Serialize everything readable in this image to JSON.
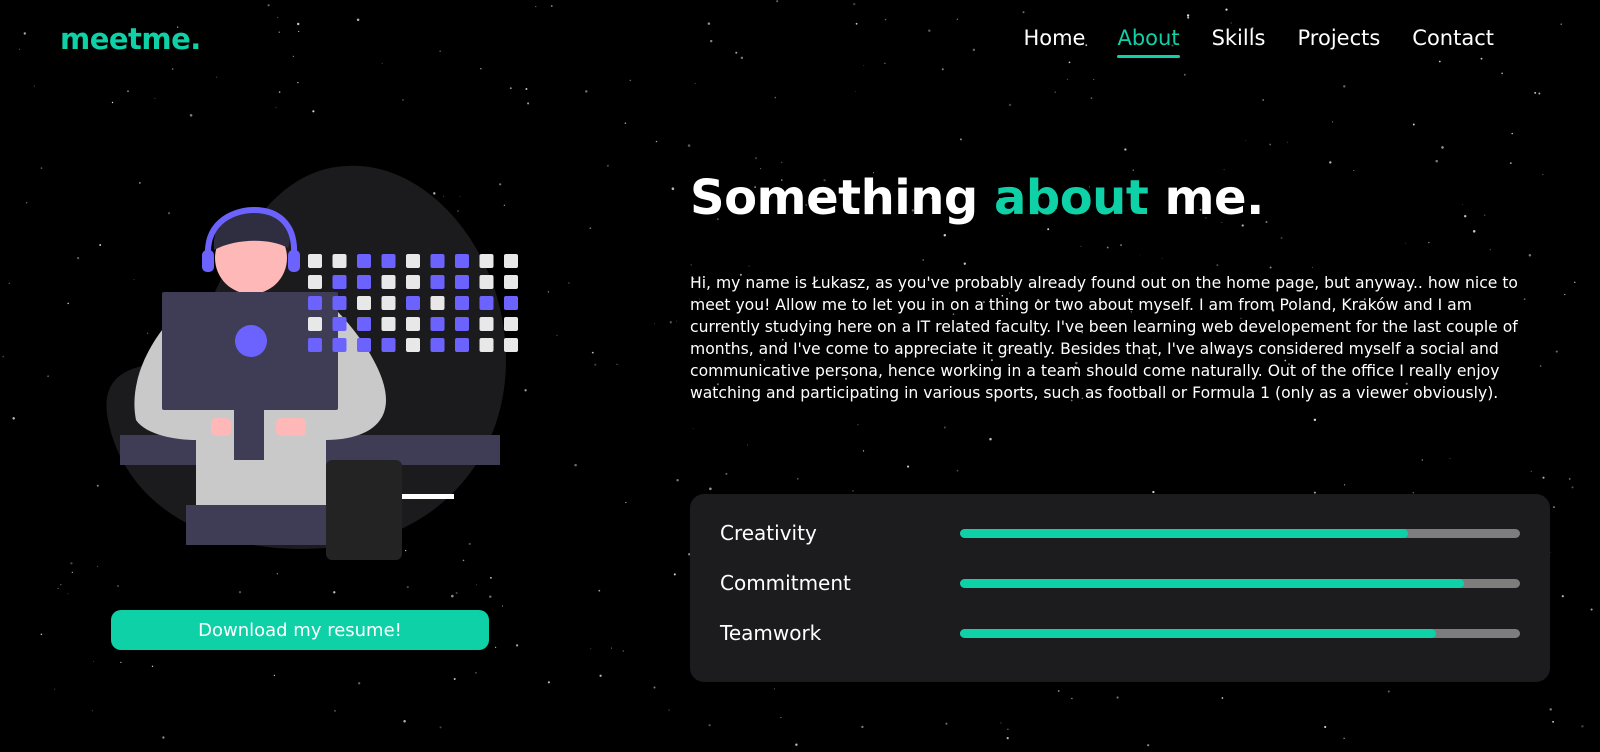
{
  "brand": {
    "logo": "meetme.",
    "accent_color": "#0fd1a7"
  },
  "nav": {
    "items": [
      {
        "label": "Home",
        "active": false
      },
      {
        "label": "About",
        "active": true
      },
      {
        "label": "Skills",
        "active": false
      },
      {
        "label": "Projects",
        "active": false
      },
      {
        "label": "Contact",
        "active": false
      }
    ]
  },
  "about": {
    "heading_pre": "Something ",
    "heading_accent": "about",
    "heading_post": " me.",
    "bio": "Hi, my name is Łukasz, as you've probably already found out on the home page, but anyway.. how nice to meet you! Allow me to let you in on a thing or two about myself. I am from Poland, Kraków and I am currently studying here on a IT related faculty. I've been learning web developement for the last couple of months, and I've come to appreciate it greatly. Besides that, I've always considered myself a social and communicative persona, hence working in a team should come naturally. Out of the office I really enjoy watching and participating in various sports, such as football or Formula 1 (only as a viewer obviously)."
  },
  "resume_button": {
    "label": "Download my resume!"
  },
  "skills": [
    {
      "label": "Creativity",
      "level": 0.8
    },
    {
      "label": "Commitment",
      "level": 0.9
    },
    {
      "label": "Teamwork",
      "level": 0.85
    }
  ],
  "illustration": {
    "icon": "person-at-laptop-illustration",
    "accent_color": "#6c63ff"
  }
}
